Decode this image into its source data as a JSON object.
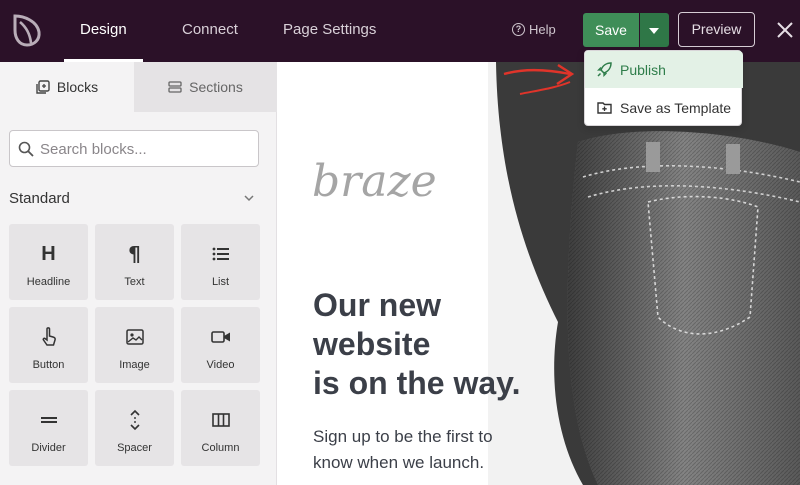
{
  "topbar": {
    "logo_icon": "leaf-logo-icon",
    "tabs": [
      {
        "label": "Design",
        "active": true
      },
      {
        "label": "Connect",
        "active": false
      },
      {
        "label": "Page Settings",
        "active": false
      }
    ],
    "help_label": "Help",
    "save_label": "Save",
    "preview_label": "Preview",
    "accent_color": "#3f8e58",
    "bar_color": "#2b1128"
  },
  "dropdown": {
    "items": [
      {
        "label": "Publish",
        "icon": "rocket-icon",
        "highlighted": true
      },
      {
        "label": "Save as Template",
        "icon": "folder-plus-icon",
        "highlighted": false
      }
    ]
  },
  "sidebar": {
    "tabs": [
      {
        "label": "Blocks",
        "icon": "blocks-icon",
        "active": true
      },
      {
        "label": "Sections",
        "icon": "sections-icon",
        "active": false
      }
    ],
    "search": {
      "placeholder": "Search blocks...",
      "value": ""
    },
    "group_title": "Standard",
    "blocks": [
      {
        "label": "Headline",
        "icon": "heading-icon"
      },
      {
        "label": "Text",
        "icon": "paragraph-icon"
      },
      {
        "label": "List",
        "icon": "list-icon"
      },
      {
        "label": "Button",
        "icon": "pointer-hand-icon"
      },
      {
        "label": "Image",
        "icon": "image-icon"
      },
      {
        "label": "Video",
        "icon": "video-icon"
      },
      {
        "label": "Divider",
        "icon": "divider-icon"
      },
      {
        "label": "Spacer",
        "icon": "spacer-icon"
      },
      {
        "label": "Column",
        "icon": "column-icon"
      }
    ]
  },
  "canvas": {
    "brand": "braze",
    "headline_lines": [
      "Our new",
      "website",
      "is on the way."
    ],
    "subtext_lines": [
      "Sign up to be the first to",
      "know when we launch."
    ]
  }
}
